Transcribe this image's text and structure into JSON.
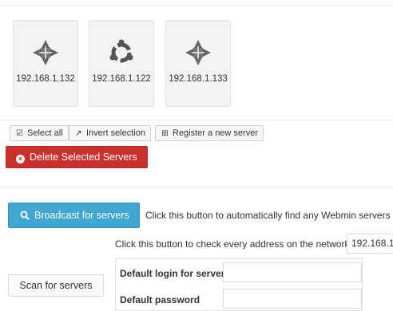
{
  "servers": [
    {
      "ip": "192.168.1.132",
      "icon": "centos-logo-icon"
    },
    {
      "ip": "192.168.1.122",
      "icon": "ubuntu-logo-icon"
    },
    {
      "ip": "192.168.1.133",
      "icon": "centos-logo-icon"
    }
  ],
  "toolbar": {
    "select_all": "Select all",
    "invert_selection": "Invert selection",
    "register_server": "Register a new server"
  },
  "delete_button": "Delete Selected Servers",
  "broadcast": {
    "button": "Broadcast for servers",
    "description": "Click this button to automatically find any Webmin servers o"
  },
  "scan": {
    "description": "Click this button to check every address on the network",
    "network_value": "192.168.1",
    "button": "Scan for servers",
    "login_label": "Default login for servers",
    "login_value": "",
    "password_label": "Default password",
    "password_value": ""
  },
  "colors": {
    "danger": "#c9302c",
    "primary": "#3fa7d1",
    "tile_bg": "#f3f3f3"
  }
}
